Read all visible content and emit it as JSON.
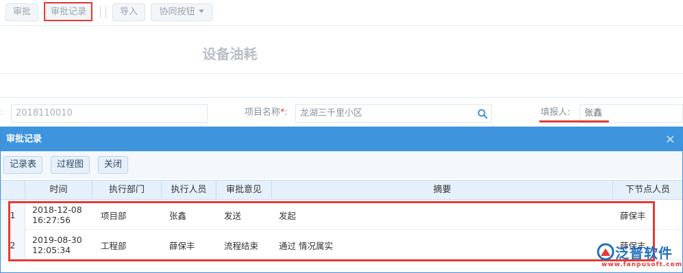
{
  "toolbar": {
    "approve": "审批",
    "records": "审批记录",
    "import": "导入",
    "collab": "协同按钮"
  },
  "form": {
    "title": "设备油耗",
    "code_value": "2018110010",
    "project_label": "项目名称",
    "project_required": "*",
    "project_colon": ":",
    "project_value": "龙湖三千里小区",
    "reporter_label": "填报人:",
    "reporter_value": "张鑫"
  },
  "dialog": {
    "title": "审批记录",
    "close": "×",
    "buttons": [
      "记录表",
      "过程图",
      "关闭"
    ],
    "columns": [
      "时间",
      "执行部门",
      "执行人员",
      "审批意见",
      "摘要",
      "下节点人员"
    ],
    "rows": [
      {
        "num": "1",
        "date": "2018-12-08",
        "time": "16:27:56",
        "dept": "项目部",
        "person": "张鑫",
        "opinion": "发送",
        "summary": "发起",
        "next": "薛保丰"
      },
      {
        "num": "2",
        "date": "2019-08-30",
        "time": "12:05:34",
        "dept": "工程部",
        "person": "薛保丰",
        "opinion": "流程结束",
        "summary": "通过 情况属实",
        "next": "薛保丰"
      }
    ]
  },
  "watermark": {
    "name": "泛普软件",
    "url": "www.fanpusoft.com"
  },
  "colors": {
    "dialog_header": "#3f94de",
    "highlight_red": "#e53935"
  }
}
